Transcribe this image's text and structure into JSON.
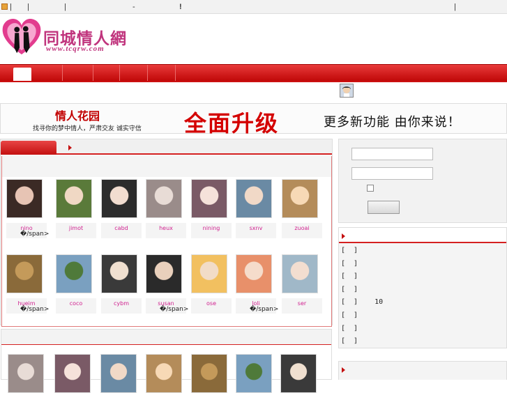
{
  "topbar": {
    "separators": [
      "|",
      "|",
      "|",
      "-",
      "!",
      "|"
    ]
  },
  "logo": {
    "title": "同城情人網",
    "url": "www.tcqrw.com"
  },
  "banner": {
    "brand": "情人花园",
    "slogan": "找寻你的梦中情人，严肃交友  诚实守信",
    "headline": "全面升级",
    "tagline": "更多新功能  由你来说！"
  },
  "members_row1": [
    {
      "name": "nino",
      "extra": "�/span>"
    },
    {
      "name": "jimot",
      "extra": ""
    },
    {
      "name": "cabd",
      "extra": ""
    },
    {
      "name": "heux",
      "extra": ""
    },
    {
      "name": "nining",
      "extra": ""
    },
    {
      "name": "sxnv",
      "extra": ""
    },
    {
      "name": "zuoai",
      "extra": ""
    }
  ],
  "members_row2": [
    {
      "name": "hueim",
      "extra": "�/span>"
    },
    {
      "name": "coco",
      "extra": ""
    },
    {
      "name": "cybm",
      "extra": ""
    },
    {
      "name": "susan",
      "extra": "�/span>"
    },
    {
      "name": "ose",
      "extra": ""
    },
    {
      "name": "loli",
      "extra": "�/span>"
    },
    {
      "name": "ser",
      "extra": ""
    }
  ],
  "list_items": [
    "[  ]",
    "[  ]",
    "[  ]",
    "[  ]",
    "[  ]    10",
    "[  ]",
    "[  ]",
    "[  ]"
  ],
  "colors": {
    "accent": "#d42020",
    "name": "#d0218f"
  }
}
